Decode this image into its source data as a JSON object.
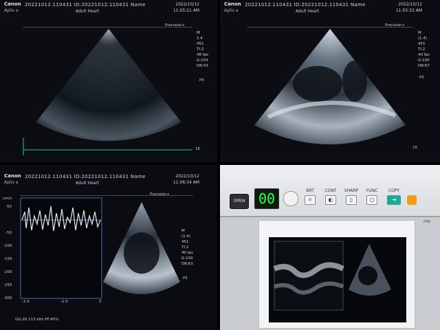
{
  "panels": [
    {
      "brand": "Canon",
      "system": "Aplio a",
      "patient_id": "20221012.110431 ID:20221012.110431 Name",
      "preset": "Adult Heart",
      "date": "2022/10/12",
      "time": "11:05:21 AM",
      "mode_label": "Precision+",
      "params": [
        "M",
        "1.4",
        "451",
        "TI.2",
        "48 fps",
        "G:103",
        "DR:53"
      ],
      "probe": "P5",
      "depth_end": "16"
    },
    {
      "brand": "Canon",
      "system": "Aplio a",
      "patient_id": "20221012.110431 ID:20221012.110431 Name",
      "preset": "Adult Heart",
      "date": "2022/10/12",
      "time": "11:05:33 AM",
      "mode_label": "Precision+",
      "params": [
        "M",
        "(1.4)",
        "451",
        "TI.2",
        "40 fps",
        "G:100",
        "DR:67"
      ],
      "probe": "P5",
      "depth_end": "16"
    },
    {
      "brand": "Canon",
      "system": "Aplio a",
      "patient_id": "20221012.110431 ID:20221012.110431 Name",
      "preset": "Adult Heart",
      "date": "2022/10/12",
      "time": "11:06:34 AM",
      "mode_label": "Precision+",
      "params": [
        "M",
        "(1.4)",
        "451",
        "TI.2",
        "40 fps",
        "G:100",
        "DR:63"
      ],
      "probe": "P5",
      "y_ticks": [
        "cm/s",
        "50",
        "-50",
        "-100",
        "-150",
        "-200",
        "-250",
        "-300"
      ],
      "x_ticks": [
        "-2.0",
        "-1.0",
        "0"
      ],
      "footer": "DG:26 113 kHz  PF:45%"
    },
    {
      "led": "00",
      "buttons": [
        "OPEN",
        "BRT",
        "CONT",
        "SHARP",
        "FUNC",
        "COPY"
      ],
      "model": "P95"
    }
  ]
}
